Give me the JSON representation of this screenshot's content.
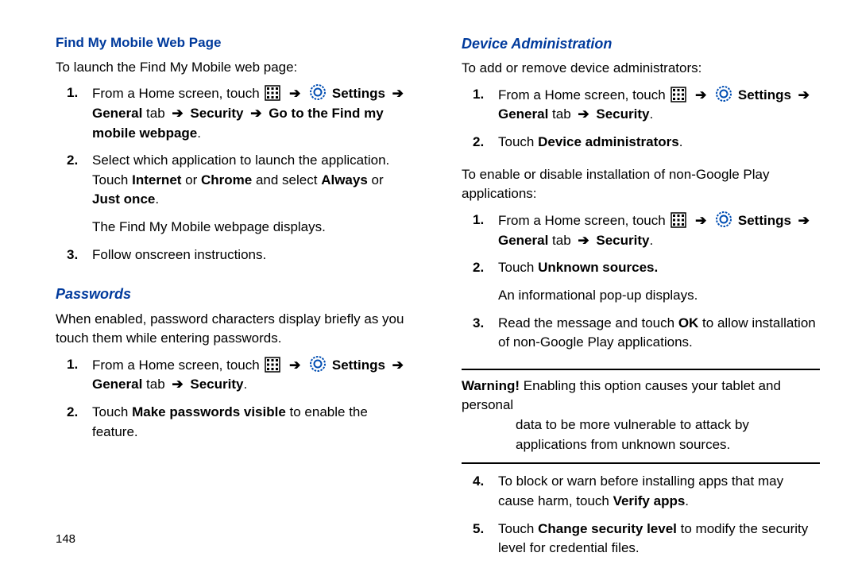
{
  "pagenum": "148",
  "arrow": "➔",
  "left": {
    "h1": "Find My Mobile Web Page",
    "intro": "To launch the Find My Mobile web page:",
    "steps1": [
      {
        "n": "1.",
        "pre": "From a Home screen, touch ",
        "settings": "Settings",
        "general": "General",
        "tab_word": " tab ",
        "sec": "Security",
        "tail": "Go to the Find my mobile webpage",
        "period": "."
      },
      {
        "n": "2.",
        "t1": "Select which application to launch the application. Touch ",
        "b1": "Internet",
        "t2": " or ",
        "b2": "Chrome",
        "t3": " and select ",
        "b3": "Always",
        "t4": " or ",
        "b4": "Just once",
        "t5": ".",
        "extra": "The Find My Mobile webpage displays."
      },
      {
        "n": "3.",
        "plain": "Follow onscreen instructions."
      }
    ],
    "h2": "Passwords",
    "p2": "When enabled, password characters display briefly as you touch them while entering passwords.",
    "steps2": [
      {
        "n": "1.",
        "pre": "From a Home screen, touch ",
        "settings": "Settings",
        "general": "General",
        "tab_word": " tab ",
        "sec": "Security",
        "period": "."
      },
      {
        "n": "2.",
        "t1": "Touch ",
        "b1": "Make passwords visible",
        "t2": " to enable the feature."
      }
    ]
  },
  "right": {
    "h1": "Device Administration",
    "intro": "To add or remove device administrators:",
    "steps1": [
      {
        "n": "1.",
        "pre": "From a Home screen, touch ",
        "settings": "Settings",
        "general": "General",
        "tab_word": " tab ",
        "sec": "Security",
        "period": "."
      },
      {
        "n": "2.",
        "t1": "Touch ",
        "b1": "Device administrators",
        "t2": "."
      }
    ],
    "p2": "To enable or disable installation of non-Google Play applications:",
    "steps2": [
      {
        "n": "1.",
        "pre": "From a Home screen, touch ",
        "settings": "Settings",
        "general": "General",
        "tab_word": " tab ",
        "sec": "Security",
        "period": "."
      },
      {
        "n": "2.",
        "t1": "Touch ",
        "b1": "Unknown sources.",
        "extra": "An informational pop-up displays."
      },
      {
        "n": "3.",
        "t1": "Read the message and touch ",
        "b1": "OK",
        "t2": " to allow installation of non-Google Play applications."
      }
    ],
    "warning_label": "Warning!",
    "warning_text_1": " Enabling this option causes your tablet and personal ",
    "warning_text_2": "data to be more vulnerable to attack by applications from unknown sources.",
    "steps3": [
      {
        "n": "4.",
        "t1": "To block or warn before installing apps that may cause harm, touch ",
        "b1": "Verify apps",
        "t2": "."
      },
      {
        "n": "5.",
        "t1": "Touch ",
        "b1": "Change security level",
        "t2": " to modify the security level for credential files."
      }
    ]
  }
}
